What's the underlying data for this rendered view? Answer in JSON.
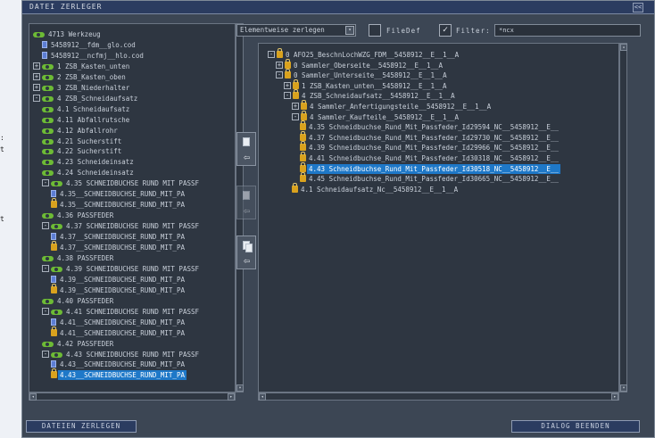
{
  "window": {
    "title": "DATEI ZERLEGER",
    "close_label": "<<"
  },
  "outer_margin": {
    "items": [
      ":",
      "t",
      "t"
    ]
  },
  "left_tree": {
    "rows": [
      {
        "text": "4713 Werkzeug",
        "indent": 0,
        "icon": "group",
        "exp": ""
      },
      {
        "text": "5458912__fdm__glo.cod",
        "indent": 1,
        "icon": "file",
        "exp": ""
      },
      {
        "text": "5458912__ncfmj__hlo.cod",
        "indent": 1,
        "icon": "file",
        "exp": ""
      },
      {
        "text": "1 ZSB_Kasten_unten",
        "indent": 0,
        "icon": "group",
        "exp": "+"
      },
      {
        "text": "2 ZSB_Kasten_oben",
        "indent": 0,
        "icon": "group",
        "exp": "+"
      },
      {
        "text": "3 ZSB_Niederhalter",
        "indent": 0,
        "icon": "group",
        "exp": "+"
      },
      {
        "text": "4 ZSB_Schneidaufsatz",
        "indent": 0,
        "icon": "group",
        "exp": "-"
      },
      {
        "text": "4.1 Schneidaufsatz",
        "indent": 1,
        "icon": "group",
        "exp": ""
      },
      {
        "text": "4.11 Abfallrutsche",
        "indent": 1,
        "icon": "group",
        "exp": ""
      },
      {
        "text": "4.12 Abfallrohr",
        "indent": 1,
        "icon": "group",
        "exp": ""
      },
      {
        "text": "4.21 Sucherstift",
        "indent": 1,
        "icon": "group",
        "exp": ""
      },
      {
        "text": "4.22 Sucherstift",
        "indent": 1,
        "icon": "group",
        "exp": ""
      },
      {
        "text": "4.23 Schneideinsatz",
        "indent": 1,
        "icon": "group",
        "exp": ""
      },
      {
        "text": "4.24 Schneideinsatz",
        "indent": 1,
        "icon": "group",
        "exp": ""
      },
      {
        "text": "4.35 SCHNEIDBUCHSE RUND MIT PASSF",
        "indent": 1,
        "icon": "group",
        "exp": "-"
      },
      {
        "text": "4.35__SCHNEIDBUCHSE_RUND_MIT_PA",
        "indent": 2,
        "icon": "file",
        "exp": ""
      },
      {
        "text": "4.35__SCHNEIDBUCHSE_RUND_MIT_PA",
        "indent": 2,
        "icon": "lock",
        "exp": ""
      },
      {
        "text": "4.36 PASSFEDER",
        "indent": 1,
        "icon": "group",
        "exp": ""
      },
      {
        "text": "4.37 SCHNEIDBUCHSE RUND MIT PASSF",
        "indent": 1,
        "icon": "group",
        "exp": "-"
      },
      {
        "text": "4.37__SCHNEIDBUCHSE_RUND_MIT_PA",
        "indent": 2,
        "icon": "file",
        "exp": ""
      },
      {
        "text": "4.37__SCHNEIDBUCHSE_RUND_MIT_PA",
        "indent": 2,
        "icon": "lock",
        "exp": ""
      },
      {
        "text": "4.38 PASSFEDER",
        "indent": 1,
        "icon": "group",
        "exp": ""
      },
      {
        "text": "4.39 SCHNEIDBUCHSE RUND MIT PASSF",
        "indent": 1,
        "icon": "group",
        "exp": "-"
      },
      {
        "text": "4.39__SCHNEIDBUCHSE_RUND_MIT_PA",
        "indent": 2,
        "icon": "file",
        "exp": ""
      },
      {
        "text": "4.39__SCHNEIDBUCHSE_RUND_MIT_PA",
        "indent": 2,
        "icon": "lock",
        "exp": ""
      },
      {
        "text": "4.40 PASSFEDER",
        "indent": 1,
        "icon": "group",
        "exp": ""
      },
      {
        "text": "4.41 SCHNEIDBUCHSE RUND MIT PASSF",
        "indent": 1,
        "icon": "group",
        "exp": "-"
      },
      {
        "text": "4.41__SCHNEIDBUCHSE_RUND_MIT_PA",
        "indent": 2,
        "icon": "file",
        "exp": ""
      },
      {
        "text": "4.41__SCHNEIDBUCHSE_RUND_MIT_PA",
        "indent": 2,
        "icon": "lock",
        "exp": ""
      },
      {
        "text": "4.42 PASSFEDER",
        "indent": 1,
        "icon": "group",
        "exp": ""
      },
      {
        "text": "4.43 SCHNEIDBUCHSE RUND MIT PASSF",
        "indent": 1,
        "icon": "group",
        "exp": "-"
      },
      {
        "text": "4.43__SCHNEIDBUCHSE_RUND_MIT_PA",
        "indent": 2,
        "icon": "file",
        "exp": ""
      },
      {
        "text": "4.43__SCHNEIDBUCHSE_RUND_MIT_PA",
        "indent": 2,
        "icon": "lock",
        "exp": "",
        "selected": true
      }
    ]
  },
  "toolbar": {
    "mode_value": "Elementweise zerlegen",
    "mode_arrow": "▾",
    "filedef_label": "FileDef",
    "filedef_checked": false,
    "filter_label": "Filter:",
    "filter_checked": true,
    "filter_value": "*ncx"
  },
  "tool_buttons": {
    "btn1_arrow": "⇦",
    "btn2_arrow": "⇦",
    "btn3_arrow": "⇦"
  },
  "right_tree": {
    "rows": [
      {
        "text": "0 AFO25_BeschnLochWZG_FDM__5458912__E__1__A",
        "indent": 0,
        "exp": "-",
        "icon": "lock"
      },
      {
        "text": "0 Sammler_Oberseite__5458912__E__1__A",
        "indent": 1,
        "exp": "+",
        "icon": "lock"
      },
      {
        "text": "0 Sammler_Unterseite__5458912__E__1__A",
        "indent": 1,
        "exp": "-",
        "icon": "lock"
      },
      {
        "text": "1 ZSB_Kasten_unten__5458912__E__1__A",
        "indent": 2,
        "exp": "+",
        "icon": "lock"
      },
      {
        "text": "4 ZSB_Schneidaufsatz__5458912__E__1__A",
        "indent": 2,
        "exp": "-",
        "icon": "lock"
      },
      {
        "text": "4 Sammler_Anfertigungsteile__5458912__E__1__A",
        "indent": 3,
        "exp": "+",
        "icon": "lock"
      },
      {
        "text": "4 Sammler_Kaufteile__5458912__E__1__A",
        "indent": 3,
        "exp": "-",
        "icon": "lock"
      },
      {
        "text": "4.35 Schneidbuchse_Rund_Mit_Passfeder_Id29594_NC__5458912__E__",
        "indent": 4,
        "exp": "",
        "icon": "lock"
      },
      {
        "text": "4.37 Schneidbuchse_Rund_Mit_Passfeder_Id29730_NC__5458912__E__",
        "indent": 4,
        "exp": "",
        "icon": "lock"
      },
      {
        "text": "4.39 Schneidbuchse_Rund_Mit_Passfeder_Id29966_NC__5458912__E__",
        "indent": 4,
        "exp": "",
        "icon": "lock"
      },
      {
        "text": "4.41 Schneidbuchse_Rund_Mit_Passfeder_Id30318_NC__5458912__E__",
        "indent": 4,
        "exp": "",
        "icon": "lock"
      },
      {
        "text": "4.43 Schneidbuchse_Rund_Mit_Passfeder_Id30518_NC__5458912__E__",
        "indent": 4,
        "exp": "",
        "icon": "lock",
        "selected": true
      },
      {
        "text": "4.45 Schneidbuchse_Rund_Mit_Passfeder_Id30665_NC__5458912__E__",
        "indent": 4,
        "exp": "",
        "icon": "lock"
      },
      {
        "text": "4.1 Schneidaufsatz_Nc__5458912__E__1__A",
        "indent": 3,
        "exp": "",
        "icon": "lock"
      }
    ]
  },
  "footer": {
    "split_label": "DATEIEN ZERLEGEN",
    "close_label": "DIALOG BEENDEN"
  },
  "colors": {
    "selection": "#1e78c8",
    "group_icon": "#6dbb35",
    "lock_icon": "#d9a21e"
  }
}
